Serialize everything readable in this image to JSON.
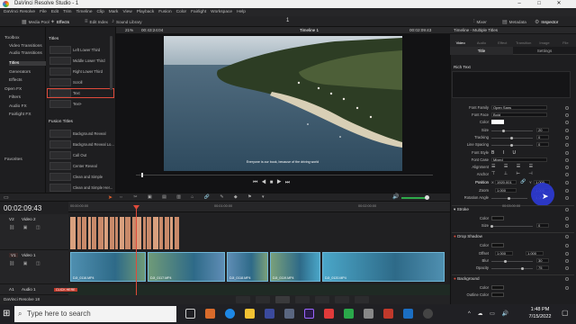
{
  "window": {
    "title": "DaVinci Resolve Studio - 1",
    "center_number": "1"
  },
  "menu": [
    "DaVinci Resolve",
    "File",
    "Edit",
    "Trim",
    "Timeline",
    "Clip",
    "Mark",
    "View",
    "Playback",
    "Fusion",
    "Color",
    "Fairlight",
    "Workspace",
    "Help"
  ],
  "toolbar": {
    "left": [
      "Media Pool",
      "Effects",
      "Edit Index",
      "Sound Library"
    ],
    "right": [
      "Mixer",
      "Metadata",
      "Inspector"
    ]
  },
  "viewer_header": {
    "zoom": "21%",
    "timecode": "00:43:24:04",
    "timeline_name": "Timeline 1",
    "current_tc": "00:02:09:43"
  },
  "inspector_header": {
    "title": "Timeline - Multiple Titles",
    "tabs": [
      "Video",
      "Audio",
      "Effect",
      "Transition",
      "Image",
      "File"
    ],
    "subtabs": [
      "Title",
      "Settings"
    ]
  },
  "effects_tree": {
    "items": [
      "Toolbox",
      "Video Transitions",
      "Audio Transitions",
      "Titles",
      "Generators",
      "Effects",
      "Open FX",
      "Filters",
      "Audio FX",
      "Fairlight FX",
      "Favorites"
    ],
    "selected_index": 3
  },
  "titles_panel": {
    "header": "Titles",
    "items": [
      "Left Lower Third",
      "Middle Lower Third",
      "Right Lower Third",
      "Scroll",
      "Text",
      "Text+"
    ],
    "selected_index": 4,
    "fusion_header": "Fusion Titles",
    "fusion_items": [
      "Background Reveal",
      "Background Reveal Lo...",
      "Call Out",
      "Center Reveal",
      "Clean and Simple",
      "Clean and Simple Her..."
    ]
  },
  "video_caption": "Everyone is our book, because of the driving world",
  "inspector": {
    "rich_text_label": "Rich Text",
    "font_family_label": "Font Family",
    "font_family": "Open Sans",
    "font_face_label": "Font Face",
    "font_face": "Bold",
    "color_label": "Color",
    "size_label": "Size",
    "size": "20",
    "tracking_label": "Tracking",
    "tracking": "0",
    "line_spacing_label": "Line Spacing",
    "line_spacing": "0",
    "font_style_label": "Font Style",
    "font_case_label": "Font Case",
    "font_case": "Mixed",
    "alignment_label": "Alignment",
    "anchor_label": "Anchor",
    "position_label": "Position",
    "position_x": "1920.001",
    "position_y": "1.000",
    "zoom_label": "Zoom",
    "zoom_x": "1.000",
    "zoom_y": "1.000",
    "rotation_label": "Rotation Angle",
    "rotation": "0.000",
    "stroke_header": "Stroke",
    "stroke_color_label": "Color",
    "stroke_size_label": "Size",
    "stroke_size": "0",
    "drop_shadow_header": "Drop Shadow",
    "ds_color_label": "Color",
    "ds_offset_label": "Offset",
    "ds_offset_x": "1.000",
    "ds_offset_y": "1.000",
    "ds_blur_label": "Blur",
    "ds_blur": "30",
    "ds_opacity_label": "Opacity",
    "ds_opacity": "75",
    "background_header": "Background",
    "bg_color_label": "Color",
    "bg_outline_label": "Outline Color"
  },
  "timeline": {
    "timecode": "00:02:09:43",
    "ruler": [
      "00:00:00:00",
      "00:01:00:00",
      "00:02:00:00",
      "00:03:00:00"
    ],
    "tracks": [
      {
        "id": "V2",
        "name": "Video 2"
      },
      {
        "id": "V1",
        "name": "Video 1"
      },
      {
        "id": "A1",
        "name": "Audio 1"
      }
    ],
    "v1_clips": [
      "DJI_0116.MP4",
      "DJI_0117.MP4",
      "DJI_0118.MP4",
      "DJI_0119.MP4",
      "DJI_0120.MP4"
    ],
    "audio_tag": "CLICK HERE"
  },
  "footer": {
    "app": "DaVinci Resolve 18"
  },
  "taskbar": {
    "search_placeholder": "Type here to search",
    "time": "1:48 PM",
    "date": "7/15/2022"
  },
  "colors": {
    "accent": "#e8622c",
    "playhead": "#e04a3a",
    "v1_clip": "#3a7fa0",
    "v2_clip": "#c98a6a",
    "cursor": "#2c3ad6"
  }
}
